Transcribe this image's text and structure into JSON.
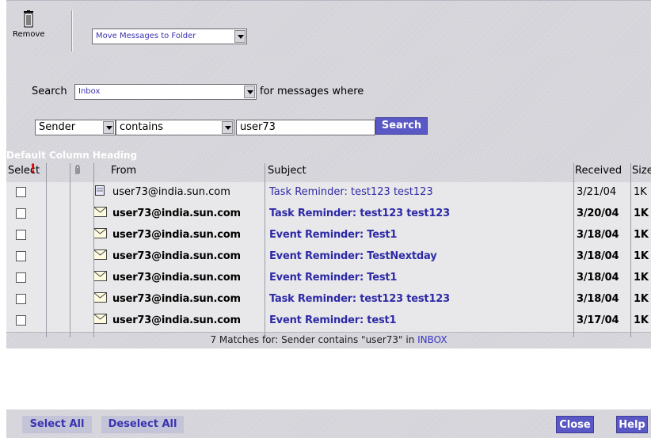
{
  "toolbar": {
    "remove_label": "Remove",
    "move_select": "Move Messages to Folder"
  },
  "search": {
    "label": "Search",
    "folder": "Inbox",
    "tail": "for messages where",
    "field": "Sender",
    "operator": "contains",
    "value": "user73",
    "button": "Search"
  },
  "results": {
    "section_heading": "Default Column Heading",
    "columns": {
      "select": "Select",
      "priority": "!",
      "from": "From",
      "subject": "Subject",
      "received": "Received",
      "size": "Size"
    },
    "rows": [
      {
        "from": "user73@india.sun.com",
        "subject": "Task Reminder: test123 test123",
        "date": "3/21/04",
        "size": "1K",
        "unread": false
      },
      {
        "from": "user73@india.sun.com",
        "subject": "Task Reminder: test123 test123",
        "date": "3/20/04",
        "size": "1K",
        "unread": true
      },
      {
        "from": "user73@india.sun.com",
        "subject": "Event Reminder: Test1",
        "date": "3/18/04",
        "size": "1K",
        "unread": true
      },
      {
        "from": "user73@india.sun.com",
        "subject": "Event Reminder: TestNextday",
        "date": "3/18/04",
        "size": "1K",
        "unread": true
      },
      {
        "from": "user73@india.sun.com",
        "subject": "Event Reminder: Test1",
        "date": "3/18/04",
        "size": "1K",
        "unread": true
      },
      {
        "from": "user73@india.sun.com",
        "subject": "Task Reminder: test123 test123",
        "date": "3/18/04",
        "size": "1K",
        "unread": true
      },
      {
        "from": "user73@india.sun.com",
        "subject": "Event Reminder: test1",
        "date": "3/17/04",
        "size": "1K",
        "unread": true
      }
    ],
    "matches_text": "7 Matches for: Sender contains \"user73\" in ",
    "matches_folder": "INBOX"
  },
  "footer": {
    "select_all": "Select All",
    "deselect_all": "Deselect All",
    "close": "Close",
    "help": "Help"
  }
}
